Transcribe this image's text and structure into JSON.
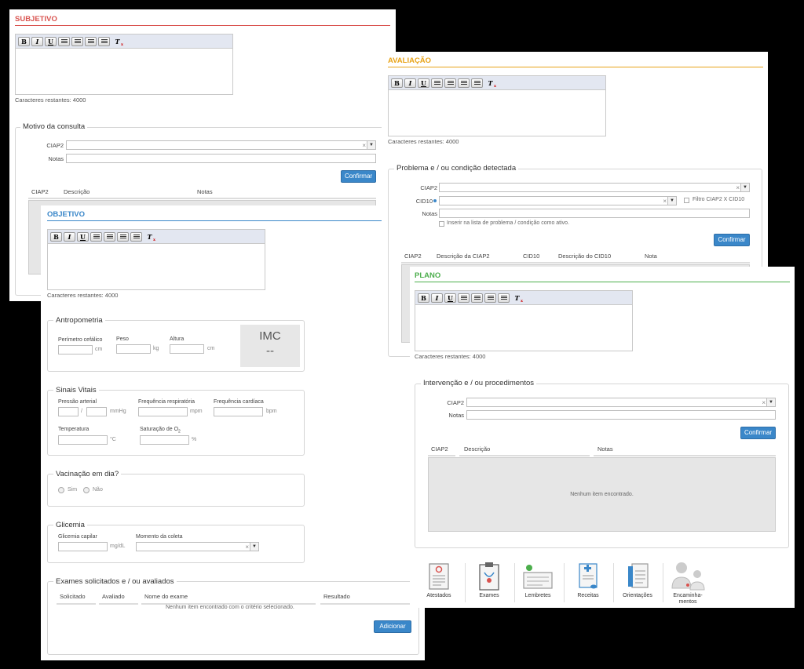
{
  "colors": {
    "subjetivo": "#d9534f",
    "objetivo": "#3a87c9",
    "avaliacao": "#e8a317",
    "plano": "#4cae4c",
    "button": "#3a87c9"
  },
  "editor_icons": [
    "bold-icon",
    "italic-icon",
    "underline-icon",
    "align-left-icon",
    "align-center-icon",
    "ordered-list-icon",
    "bullet-list-icon",
    "clear-format-icon"
  ],
  "editor_buttons": {
    "bold": "B",
    "italic": "I",
    "underline": "U",
    "clear": "T"
  },
  "subjetivo": {
    "title": "SUBJETIVO",
    "chars": "Caracteres restantes: 4000",
    "motivo": {
      "legend": "Motivo da consulta",
      "ciap2_label": "CIAP2",
      "notas_label": "Notas",
      "confirm": "Confirmar",
      "columns": [
        "CIAP2",
        "Descrição",
        "Notas"
      ]
    }
  },
  "objetivo": {
    "title": "OBJETIVO",
    "chars": "Caracteres restantes: 4000",
    "antropometria": {
      "legend": "Antropometria",
      "perimetro": "Perímetro cefálico",
      "perimetro_unit": "cm",
      "peso": "Peso",
      "peso_unit": "kg",
      "altura": "Altura",
      "altura_unit": "cm",
      "imc_label": "IMC",
      "imc_value": "--"
    },
    "sinais": {
      "legend": "Sinais Vitais",
      "pressao": "Pressão arterial",
      "pressao_sep": "/",
      "pressao_unit": "mmHg",
      "freq_resp": "Frequência respiratória",
      "freq_resp_unit": "mpm",
      "freq_card": "Frequência cardíaca",
      "freq_card_unit": "bpm",
      "temperatura": "Temperatura",
      "temp_unit": "°C",
      "saturacao": "Saturação de O",
      "saturacao_sub": "2",
      "sat_unit": "%"
    },
    "vacinacao": {
      "legend": "Vacinação em dia?",
      "sim": "Sim",
      "nao": "Não"
    },
    "glicemia": {
      "legend": "Glicemia",
      "capilar": "Glicemia capilar",
      "capilar_unit": "mg/dL",
      "momento": "Momento da coleta"
    },
    "exames": {
      "legend": "Exames solicitados e / ou avaliados",
      "columns": [
        "Solicitado",
        "Avaliado",
        "Nome do exame",
        "Resultado"
      ],
      "empty": "Nenhum item encontrado com o critério selecionado.",
      "add": "Adicionar"
    }
  },
  "avaliacao": {
    "title": "AVALIAÇÃO",
    "chars": "Caracteres restantes: 4000",
    "problema": {
      "legend": "Problema e / ou condição detectada",
      "ciap2_label": "CIAP2",
      "cid10_label": "CID10",
      "notas_label": "Notas",
      "filtro": "Filtro CIAP2 X CID10",
      "inserir": "Inserir na lista de problema / condição como ativo.",
      "confirm": "Confirmar",
      "columns": [
        "CIAP2",
        "Descrição da CIAP2",
        "CID10",
        "Descrição do CID10",
        "Nota"
      ]
    }
  },
  "plano": {
    "title": "PLANO",
    "chars": "Caracteres restantes: 4000",
    "intervencao": {
      "legend": "Intervenção e / ou procedimentos",
      "ciap2_label": "CIAP2",
      "notas_label": "Notas",
      "confirm": "Confirmar",
      "columns": [
        "CIAP2",
        "Descrição",
        "Notas"
      ],
      "empty": "Nenhum item encontrado."
    },
    "dock": [
      {
        "label": "Atestados",
        "icon": "certificate-icon"
      },
      {
        "label": "Exames",
        "icon": "clipboard-exam-icon"
      },
      {
        "label": "Lembretes",
        "icon": "reminder-icon"
      },
      {
        "label": "Receitas",
        "icon": "prescription-icon"
      },
      {
        "label": "Orientações",
        "icon": "guidelines-icon"
      },
      {
        "label": "Encaminha-\nmentos",
        "icon": "referral-doctors-icon"
      }
    ]
  }
}
